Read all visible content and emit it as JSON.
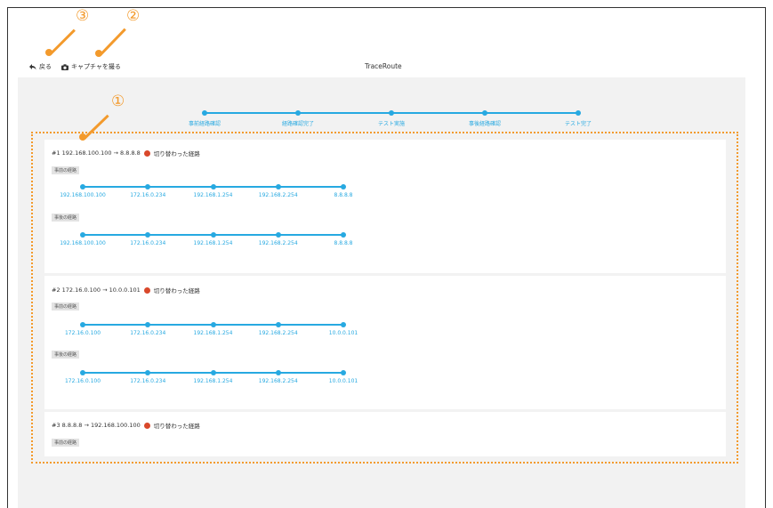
{
  "toolbar": {
    "back_label": "戻る",
    "capture_label": "キャプチャを撮る"
  },
  "title": "TraceRoute",
  "callouts": [
    "①",
    "②",
    "③"
  ],
  "steps": [
    "事前経路確認",
    "経路確認完了",
    "テスト実施",
    "事後経路確認",
    "テスト完了"
  ],
  "cards": [
    {
      "title": "#1 192.168.100.100 → 8.8.8.8",
      "status": "切り替わった経路",
      "before_label": "事前の経路",
      "before": [
        "192.168.100.100",
        "172.16.0.234",
        "192.168.1.254",
        "192.168.2.254",
        "8.8.8.8"
      ],
      "after_label": "事後の経路",
      "after": [
        "192.168.100.100",
        "172.16.0.234",
        "192.168.1.254",
        "192.168.2.254",
        "8.8.8.8"
      ]
    },
    {
      "title": "#2 172.16.0.100 → 10.0.0.101",
      "status": "切り替わった経路",
      "before_label": "事前の経路",
      "before": [
        "172.16.0.100",
        "172.16.0.234",
        "192.168.1.254",
        "192.168.2.254",
        "10.0.0.101"
      ],
      "after_label": "事後の経路",
      "after": [
        "172.16.0.100",
        "172.16.0.234",
        "192.168.1.254",
        "192.168.2.254",
        "10.0.0.101"
      ]
    },
    {
      "title": "#3 8.8.8.8 → 192.168.100.100",
      "status": "切り替わった経路",
      "before_label": "事前の経路"
    }
  ],
  "colors": {
    "accent": "#27a9e1",
    "callout": "#f39a2c",
    "status_dot": "#d9482b"
  }
}
